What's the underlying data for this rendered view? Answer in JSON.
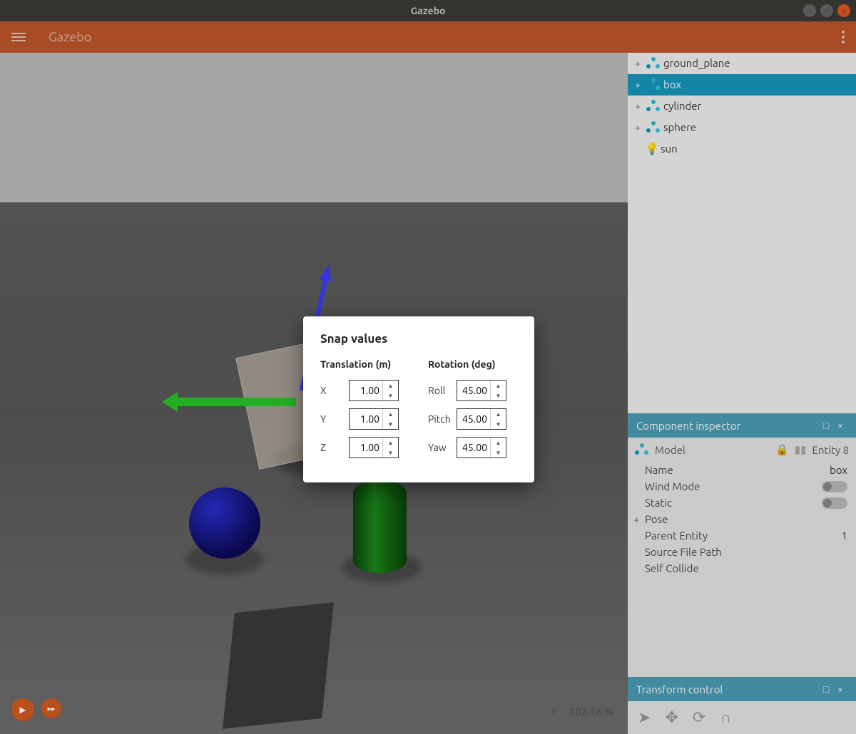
{
  "window": {
    "title": "Gazebo"
  },
  "appbar": {
    "title": "Gazebo"
  },
  "tree": {
    "items": [
      {
        "label": "ground_plane",
        "icon": "model",
        "expandable": true,
        "selected": false
      },
      {
        "label": "box",
        "icon": "model",
        "expandable": true,
        "selected": true
      },
      {
        "label": "cylinder",
        "icon": "model",
        "expandable": true,
        "selected": false
      },
      {
        "label": "sphere",
        "icon": "model",
        "expandable": true,
        "selected": false
      },
      {
        "label": "sun",
        "icon": "light",
        "expandable": false,
        "selected": false
      }
    ]
  },
  "inspector": {
    "title": "Component inspector",
    "type_label": "Model",
    "entity_label": "Entity 8",
    "rows": {
      "name_key": "Name",
      "name_val": "box",
      "wind_key": "Wind Mode",
      "static_key": "Static",
      "pose_key": "Pose",
      "parent_key": "Parent Entity",
      "parent_val": "1",
      "source_key": "Source File Path",
      "self_key": "Self Collide"
    }
  },
  "transform_panel": {
    "title": "Transform control"
  },
  "viewport": {
    "zoom": "102.16 %"
  },
  "modal": {
    "title": "Snap values",
    "translation": {
      "heading": "Translation (m)",
      "x_label": "X",
      "x_val": "1.00",
      "y_label": "Y",
      "y_val": "1.00",
      "z_label": "Z",
      "z_val": "1.00"
    },
    "rotation": {
      "heading": "Rotation (deg)",
      "roll_label": "Roll",
      "roll_val": "45.00",
      "pitch_label": "Pitch",
      "pitch_val": "45.00",
      "yaw_label": "Yaw",
      "yaw_val": "45.00"
    }
  }
}
